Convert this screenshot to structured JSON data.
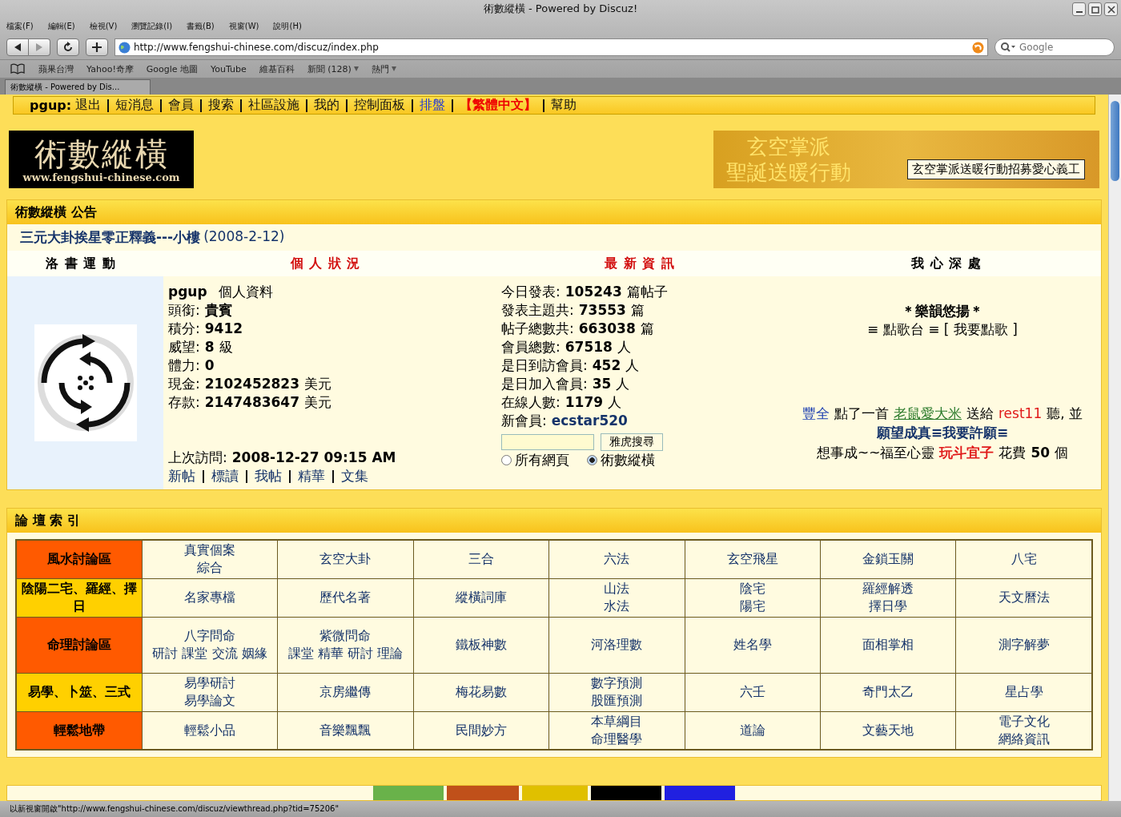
{
  "window": {
    "title": "術數縱橫 - Powered by Discuz!"
  },
  "menu": [
    "檔案(F)",
    "編輯(E)",
    "檢視(V)",
    "瀏覽記錄(I)",
    "書籤(B)",
    "視窗(W)",
    "說明(H)"
  ],
  "address": {
    "url": "http://www.fengshui-chinese.com/discuz/index.php"
  },
  "search": {
    "placeholder": "Google"
  },
  "bookmarks": [
    {
      "label": "蘋果台灣",
      "dropdown": false
    },
    {
      "label": "Yahoo!奇摩",
      "dropdown": false
    },
    {
      "label": "Google 地圖",
      "dropdown": false
    },
    {
      "label": "YouTube",
      "dropdown": false
    },
    {
      "label": "維基百科",
      "dropdown": false
    },
    {
      "label": "新聞 (128)",
      "dropdown": true
    },
    {
      "label": "熱門",
      "dropdown": true
    }
  ],
  "tab": {
    "title": "術數縱橫 - Powered by Dis..."
  },
  "topnav": {
    "user": "pgup:",
    "links": [
      {
        "label": "退出",
        "kind": "normal"
      },
      {
        "label": "短消息",
        "kind": "normal"
      },
      {
        "label": "會員",
        "kind": "normal"
      },
      {
        "label": "搜索",
        "kind": "normal"
      },
      {
        "label": "社區設施",
        "kind": "normal"
      },
      {
        "label": "我的",
        "kind": "normal"
      },
      {
        "label": "控制面板",
        "kind": "normal"
      },
      {
        "label": "排盤",
        "kind": "blue"
      },
      {
        "label": "【繁體中文】",
        "kind": "red"
      },
      {
        "label": "幫助",
        "kind": "normal"
      }
    ]
  },
  "logo": {
    "title": "術數縱橫",
    "url": "www.fengshui-chinese.com"
  },
  "banner": {
    "line_1": "玄空掌派",
    "line_2": "聖誕送暖行動",
    "tooltip": "玄空掌派送暖行動招募愛心義工"
  },
  "announcement": {
    "title": "術數縱橫 公告",
    "headline": "三元大卦挨星零正釋義---小樓",
    "date": "(2008-2-12)"
  },
  "column_headers": [
    {
      "label": "洛 書 運 動",
      "kind": "plain"
    },
    {
      "label": "個 人 狀 況",
      "kind": "red"
    },
    {
      "label": "最 新 資 訊",
      "kind": "red"
    },
    {
      "label": "我 心 深 處",
      "kind": "plain"
    }
  ],
  "profile": {
    "username": "pgup",
    "profile_link": "個人資料",
    "rows": [
      {
        "label": "頭銜:",
        "value": "貴賓",
        "unit": ""
      },
      {
        "label": "積分:",
        "value": "9412",
        "unit": ""
      },
      {
        "label": "威望:",
        "value": "8",
        "unit": "級"
      },
      {
        "label": "體力:",
        "value": "0",
        "unit": ""
      },
      {
        "label": "現金:",
        "value": "2102452823",
        "unit": "美元"
      },
      {
        "label": "存款:",
        "value": "2147483647",
        "unit": "美元"
      }
    ],
    "last_visit_label": "上次訪問:",
    "last_visit": "2008-12-27 09:15 AM",
    "links": [
      "新帖",
      "標讀",
      "我帖",
      "精華",
      "文集"
    ]
  },
  "stats": {
    "rows": [
      {
        "label": "今日發表:",
        "value": "105243",
        "unit": "篇帖子"
      },
      {
        "label": "發表主題共:",
        "value": "73553",
        "unit": "篇"
      },
      {
        "label": "帖子總數共:",
        "value": "663038",
        "unit": "篇"
      },
      {
        "label": "會員總數:",
        "value": "67518",
        "unit": "人"
      },
      {
        "label": "是日到訪會員:",
        "value": "452",
        "unit": "人"
      },
      {
        "label": "是日加入會員:",
        "value": "35",
        "unit": "人"
      },
      {
        "label": "在線人數:",
        "value": "1179",
        "unit": "人"
      }
    ],
    "new_member_label": "新會員:",
    "new_member": "ecstar520",
    "search_button": "雅虎搜尋",
    "scopes": [
      {
        "label": "所有網頁",
        "selected": false
      },
      {
        "label": "術數縱橫",
        "selected": true
      }
    ]
  },
  "music": {
    "title": "＊樂韻悠揚＊",
    "links": "≡ 點歌台 ≡ [ 我要點歌 ]",
    "dedication": [
      {
        "text": "豐全",
        "kind": "name"
      },
      {
        "text": "點了一首",
        "kind": "text"
      },
      {
        "text": "老鼠愛大米",
        "kind": "song"
      },
      {
        "text": "送給",
        "kind": "text"
      },
      {
        "text": "rest11",
        "kind": "recipient"
      },
      {
        "text": "聽, 並",
        "kind": "text"
      }
    ],
    "wish_title": "願望成真≡我要許願≡",
    "wish": [
      {
        "text": "想事成~~福至心靈",
        "kind": "text"
      },
      {
        "text": "玩斗宜子",
        "kind": "recipient"
      },
      {
        "text": "花費",
        "kind": "text"
      },
      {
        "text": "50",
        "kind": "bold"
      },
      {
        "text": "個",
        "kind": "text"
      }
    ]
  },
  "forum_index": {
    "title": "論 壇 索 引",
    "rows": [
      {
        "category": "風水討論區",
        "kind": "red",
        "cells": [
          [
            "真實個案",
            "綜合"
          ],
          [
            "玄空大卦"
          ],
          [
            "三合"
          ],
          [
            "六法"
          ],
          [
            "玄空飛星"
          ],
          [
            "金鎖玉關"
          ],
          [
            "八宅"
          ]
        ]
      },
      {
        "category": "陰陽二宅、羅經、擇日",
        "kind": "yellow",
        "cells": [
          [
            "名家專檔"
          ],
          [
            "歷代名著"
          ],
          [
            "縱橫詞庫"
          ],
          [
            "山法",
            "水法"
          ],
          [
            "陰宅",
            "陽宅"
          ],
          [
            "羅經解透",
            "擇日學"
          ],
          [
            "天文曆法"
          ]
        ]
      },
      {
        "category": "命理討論區",
        "kind": "red",
        "cells": [
          [
            "八字問命",
            "研討 課堂 交流 姻緣"
          ],
          [
            "紫微問命",
            "課堂 精華 研討 理論"
          ],
          [
            "鐵板神數"
          ],
          [
            "河洛理數"
          ],
          [
            "姓名學"
          ],
          [
            "面相掌相"
          ],
          [
            "測字解夢"
          ]
        ]
      },
      {
        "category": "易學、卜筮、三式",
        "kind": "yellow",
        "cells": [
          [
            "易學研討",
            "易學論文"
          ],
          [
            "京房繼傳"
          ],
          [
            "梅花易數"
          ],
          [
            "數字預測",
            "股匯預測"
          ],
          [
            "六壬"
          ],
          [
            "奇門太乙"
          ],
          [
            "星占學"
          ]
        ]
      },
      {
        "category": "輕鬆地帶",
        "kind": "red",
        "cells": [
          [
            "輕鬆小品"
          ],
          [
            "音樂飄飄"
          ],
          [
            "民間妙方"
          ],
          [
            "本草綱目",
            "命理醫學"
          ],
          [
            "道論"
          ],
          [
            "文藝天地"
          ],
          [
            "電子文化",
            "網絡資訊"
          ]
        ]
      }
    ]
  },
  "status_bar": {
    "text": "以新視窗開啟\"http://www.fengshui-chinese.com/discuz/viewthread.php?tid=75206\""
  }
}
